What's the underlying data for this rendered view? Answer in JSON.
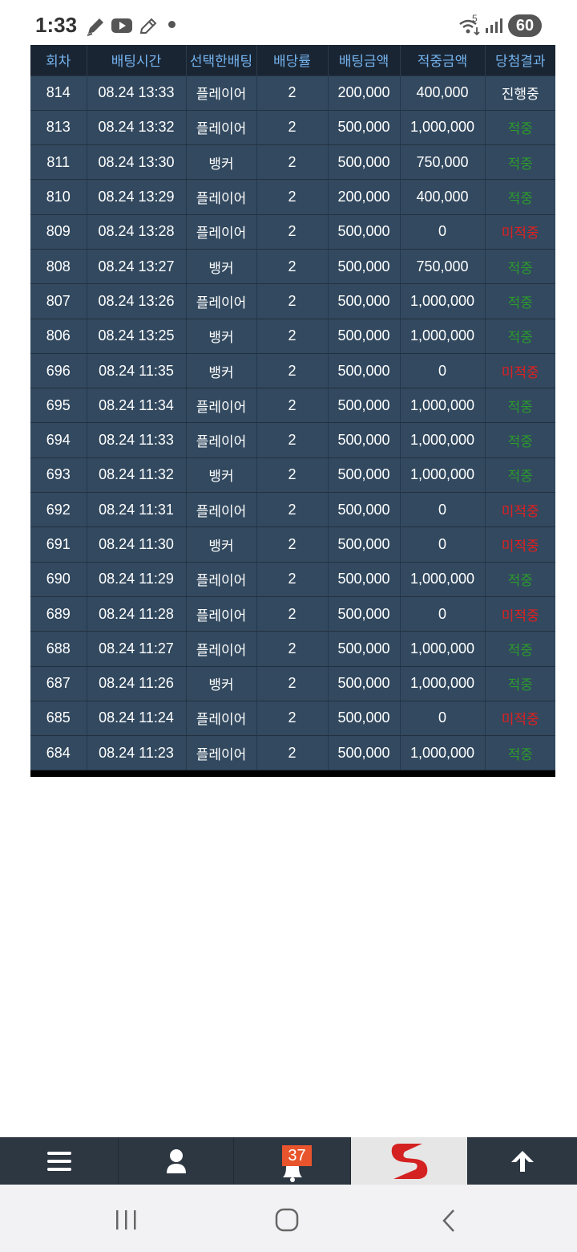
{
  "status_bar": {
    "time": "1:33",
    "battery": "60",
    "signal_label": "5",
    "icons": [
      "pencil-icon",
      "youtube-icon",
      "pencil-icon",
      "wifi-icon",
      "signal-icon"
    ]
  },
  "table": {
    "headers": [
      "회차",
      "배팅시간",
      "선택한배팅",
      "배당률",
      "배팅금액",
      "적중금액",
      "당첨결과"
    ],
    "rows": [
      [
        "814",
        "08.24 13:33",
        "플레이어",
        "2",
        "200,000",
        "400,000",
        "진행중"
      ],
      [
        "813",
        "08.24 13:32",
        "플레이어",
        "2",
        "500,000",
        "1,000,000",
        "적중"
      ],
      [
        "811",
        "08.24 13:30",
        "뱅커",
        "2",
        "500,000",
        "750,000",
        "적중"
      ],
      [
        "810",
        "08.24 13:29",
        "플레이어",
        "2",
        "200,000",
        "400,000",
        "적중"
      ],
      [
        "809",
        "08.24 13:28",
        "플레이어",
        "2",
        "500,000",
        "0",
        "미적중"
      ],
      [
        "808",
        "08.24 13:27",
        "뱅커",
        "2",
        "500,000",
        "750,000",
        "적중"
      ],
      [
        "807",
        "08.24 13:26",
        "플레이어",
        "2",
        "500,000",
        "1,000,000",
        "적중"
      ],
      [
        "806",
        "08.24 13:25",
        "뱅커",
        "2",
        "500,000",
        "1,000,000",
        "적중"
      ],
      [
        "696",
        "08.24 11:35",
        "뱅커",
        "2",
        "500,000",
        "0",
        "미적중"
      ],
      [
        "695",
        "08.24 11:34",
        "플레이어",
        "2",
        "500,000",
        "1,000,000",
        "적중"
      ],
      [
        "694",
        "08.24 11:33",
        "플레이어",
        "2",
        "500,000",
        "1,000,000",
        "적중"
      ],
      [
        "693",
        "08.24 11:32",
        "뱅커",
        "2",
        "500,000",
        "1,000,000",
        "적중"
      ],
      [
        "692",
        "08.24 11:31",
        "플레이어",
        "2",
        "500,000",
        "0",
        "미적중"
      ],
      [
        "691",
        "08.24 11:30",
        "뱅커",
        "2",
        "500,000",
        "0",
        "미적중"
      ],
      [
        "690",
        "08.24 11:29",
        "플레이어",
        "2",
        "500,000",
        "1,000,000",
        "적중"
      ],
      [
        "689",
        "08.24 11:28",
        "플레이어",
        "2",
        "500,000",
        "0",
        "미적중"
      ],
      [
        "688",
        "08.24 11:27",
        "플레이어",
        "2",
        "500,000",
        "1,000,000",
        "적중"
      ],
      [
        "687",
        "08.24 11:26",
        "뱅커",
        "2",
        "500,000",
        "1,000,000",
        "적중"
      ],
      [
        "685",
        "08.24 11:24",
        "플레이어",
        "2",
        "500,000",
        "0",
        "미적중"
      ],
      [
        "684",
        "08.24 11:23",
        "플레이어",
        "2",
        "500,000",
        "1,000,000",
        "적중"
      ]
    ],
    "colors": {
      "header_bg": "#1a2533",
      "header_text": "#74b3ee",
      "row_bg": "#32495f",
      "win": "#2c9a2c",
      "lose": "#e02020"
    }
  },
  "app_bar": {
    "items": [
      "menu-icon",
      "user-icon",
      "bell-icon",
      "logo",
      "arrow-up-icon"
    ],
    "notification_count": "37"
  },
  "nav_bar": {
    "items": [
      "recents-icon",
      "home-icon",
      "back-icon"
    ]
  }
}
